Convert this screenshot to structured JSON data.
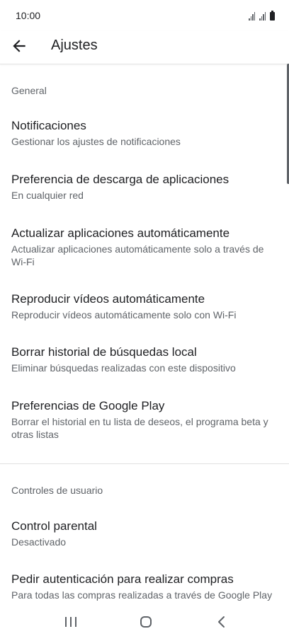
{
  "status_bar": {
    "time": "10:00"
  },
  "app_bar": {
    "title": "Ajustes"
  },
  "sections": {
    "general": {
      "header": "General",
      "items": [
        {
          "title": "Notificaciones",
          "subtitle": "Gestionar los ajustes de notificaciones"
        },
        {
          "title": "Preferencia de descarga de aplicaciones",
          "subtitle": "En cualquier red"
        },
        {
          "title": "Actualizar aplicaciones automáticamente",
          "subtitle": "Actualizar aplicaciones automáticamente solo a través de Wi-Fi"
        },
        {
          "title": "Reproducir vídeos automáticamente",
          "subtitle": "Reproducir vídeos automáticamente solo con Wi-Fi"
        },
        {
          "title": "Borrar historial de búsquedas local",
          "subtitle": "Eliminar búsquedas realizadas con este dispositivo"
        },
        {
          "title": "Preferencias de Google Play",
          "subtitle": "Borrar el historial en tu lista de deseos, el programa beta y otras listas"
        }
      ]
    },
    "user_controls": {
      "header": "Controles de usuario",
      "items": [
        {
          "title": "Control parental",
          "subtitle": "Desactivado"
        },
        {
          "title": "Pedir autenticación para realizar compras",
          "subtitle": "Para todas las compras realizadas a través de Google Play en este dispositivo"
        }
      ]
    }
  },
  "nav_bar": {
    "buttons": [
      "recents-icon",
      "home-icon",
      "back-icon"
    ]
  },
  "colors": {
    "primary_text": "#202124",
    "secondary_text": "#5f6368",
    "divider": "#e0e0e0"
  }
}
